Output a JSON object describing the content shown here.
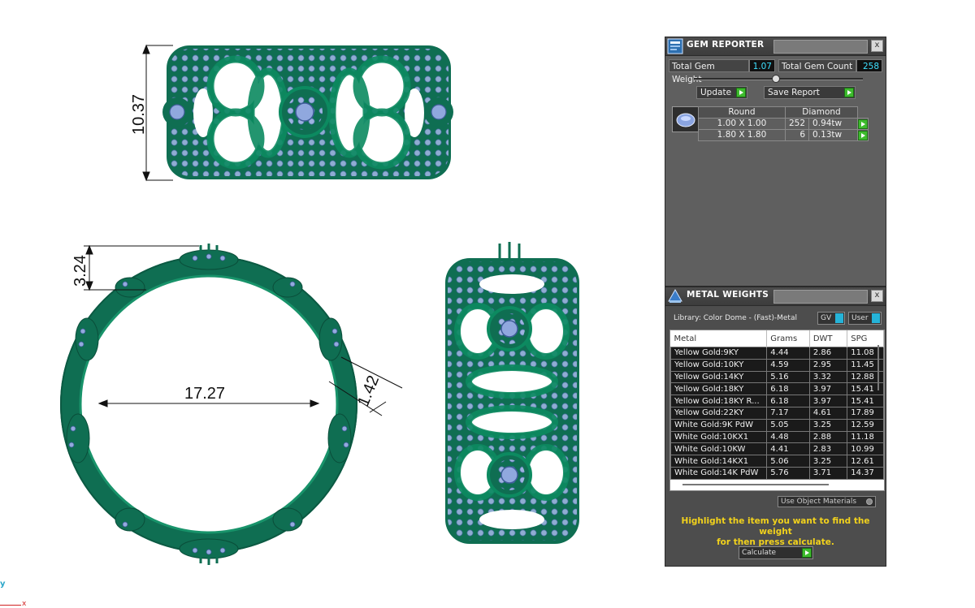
{
  "viewport": {
    "dimensions": {
      "top_height": "10.37",
      "side_height": "3.24",
      "inner_diameter": "17.27",
      "band_width": "1.42"
    },
    "axis": {
      "y_label": "y",
      "x_label": "x"
    },
    "colors": {
      "metal": "#0f7a5a",
      "gem": "#8ea6d8"
    }
  },
  "gem_reporter": {
    "title": "GEM REPORTER",
    "close": "x",
    "total_weight_label": "Total Gem Weight",
    "total_weight_value": "1.07",
    "total_count_label": "Total Gem Count",
    "total_count_value": "258",
    "update_label": "Update",
    "save_report_label": "Save Report",
    "table": {
      "shape": "Round",
      "material": "Diamond",
      "rows": [
        {
          "size": "1.00 X 1.00",
          "count": "252",
          "weight": "0.94tw"
        },
        {
          "size": "1.80 X 1.80",
          "count": "6",
          "weight": "0.13tw"
        }
      ]
    }
  },
  "metal_weights": {
    "title": "METAL WEIGHTS",
    "close": "x",
    "library": "Library: Color Dome - (Fast)-Metal",
    "gv_label": "GV",
    "user_label": "User",
    "columns": [
      "Metal",
      "Grams",
      "DWT",
      "SPG"
    ],
    "rows": [
      {
        "metal": "Yellow Gold:9KY",
        "grams": "4.44",
        "dwt": "2.86",
        "spg": "11.08"
      },
      {
        "metal": "Yellow Gold:10KY",
        "grams": "4.59",
        "dwt": "2.95",
        "spg": "11.45"
      },
      {
        "metal": "Yellow Gold:14KY",
        "grams": "5.16",
        "dwt": "3.32",
        "spg": "12.88"
      },
      {
        "metal": "Yellow Gold:18KY",
        "grams": "6.18",
        "dwt": "3.97",
        "spg": "15.41"
      },
      {
        "metal": "Yellow Gold:18KY R...",
        "grams": "6.18",
        "dwt": "3.97",
        "spg": "15.41"
      },
      {
        "metal": "Yellow Gold:22KY",
        "grams": "7.17",
        "dwt": "4.61",
        "spg": "17.89"
      },
      {
        "metal": "White Gold:9K PdW",
        "grams": "5.05",
        "dwt": "3.25",
        "spg": "12.59"
      },
      {
        "metal": "White Gold:10KX1",
        "grams": "4.48",
        "dwt": "2.88",
        "spg": "11.18"
      },
      {
        "metal": "White Gold:10KW",
        "grams": "4.41",
        "dwt": "2.83",
        "spg": "10.99"
      },
      {
        "metal": "White Gold:14KX1",
        "grams": "5.06",
        "dwt": "3.25",
        "spg": "12.61"
      },
      {
        "metal": "White Gold:14K PdW",
        "grams": "5.76",
        "dwt": "3.71",
        "spg": "14.37"
      }
    ],
    "use_object_materials": "Use Object Materials",
    "hint_line1": "Highlight the item you want to find the weight",
    "hint_line2": "for then press calculate.",
    "calculate_label": "Calculate"
  }
}
